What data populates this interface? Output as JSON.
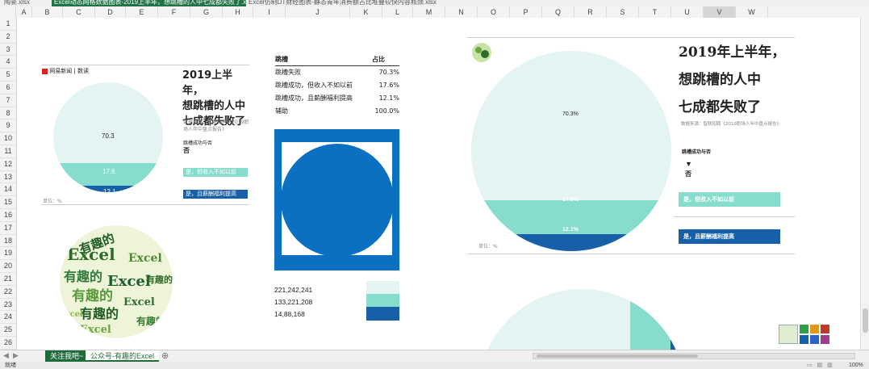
{
  "file_tabs": [
    "陶瓷.xlsx",
    "Excel动态网格数据图表-2019上半年，想跳槽的人中七成都失败了.xlsx",
    "Excel仿制DT财经图表-静态青年消费额占比堆叠较快内容瓶颈.xlsx *"
  ],
  "columns": [
    "A",
    "B",
    "C",
    "D",
    "E",
    "F",
    "G",
    "H",
    "I",
    "J",
    "K",
    "L",
    "M",
    "N",
    "O",
    "P",
    "Q",
    "R",
    "S",
    "T",
    "U",
    "V",
    "W"
  ],
  "selected_column": "V",
  "rows": [
    "1",
    "2",
    "3",
    "4",
    "5",
    "6",
    "7",
    "8",
    "9",
    "10",
    "11",
    "12",
    "13",
    "14",
    "15",
    "16",
    "17",
    "18",
    "19",
    "20",
    "21",
    "22",
    "23",
    "24",
    "25",
    "26"
  ],
  "left_chart": {
    "logo_text": "网易新闻 | 数读",
    "title_lines": [
      "2019上半年，",
      "想跳槽的人中",
      "七成都失败了"
    ],
    "source": "数据来源：智联招聘《2019职场人年中盘点报告》",
    "question": "跳槽成功与否",
    "answer_no": "否",
    "label_yes_low": "是，但收入不如以前",
    "label_yes_high": "是，且薪酬福利提高",
    "unit": "单位：%",
    "pct_failed": "70.3",
    "pct_low": "17.6",
    "pct_high": "12.1"
  },
  "table": {
    "header_name": "跳槽",
    "header_share": "占比",
    "rows": [
      {
        "name": "跳槽失败",
        "value": "70.3%"
      },
      {
        "name": "跳槽成功，但收入不如以前",
        "value": "17.6%"
      },
      {
        "name": "跳槽成功，且薪酬福利提高",
        "value": "12.1%"
      },
      {
        "name": "辅助",
        "value": "100.0%"
      }
    ]
  },
  "numbers": [
    "221,242,241",
    "133,221,208",
    "14,88,168"
  ],
  "right_chart": {
    "title_lines": [
      "2019年上半年，",
      "想跳槽的人中",
      "七成都失败了"
    ],
    "source": "数据来源：智联招聘《2019职场人年中盘点报告》",
    "question": "跳槽成功与否",
    "answer_no": "否",
    "label_yes_low": "是，但收入不如以前",
    "label_yes_high": "是，且薪酬福利提高",
    "unit": "单位：%",
    "pct_failed": "70.3%",
    "pct_low": "17.6%",
    "pct_high": "12.1%"
  },
  "wordcloud": {
    "words": [
      "Excel",
      "有趣的",
      "Excel",
      "有趣的",
      "Excel",
      "有趣的",
      "Excel",
      "有趣的",
      "Excel",
      "有趣的",
      "有趣的",
      "Excel"
    ]
  },
  "sheet_tabs": {
    "tab1": "关注我吧~",
    "tab2": "公众号-有趣的Excel"
  },
  "status": {
    "left": "就绪",
    "zoom": "100%"
  },
  "colors": {
    "pale": "#e4f4f2",
    "mint": "#86dccd",
    "navy": "#1760a8",
    "blue": "#0b6fc2",
    "excel_green": "#217346"
  }
}
